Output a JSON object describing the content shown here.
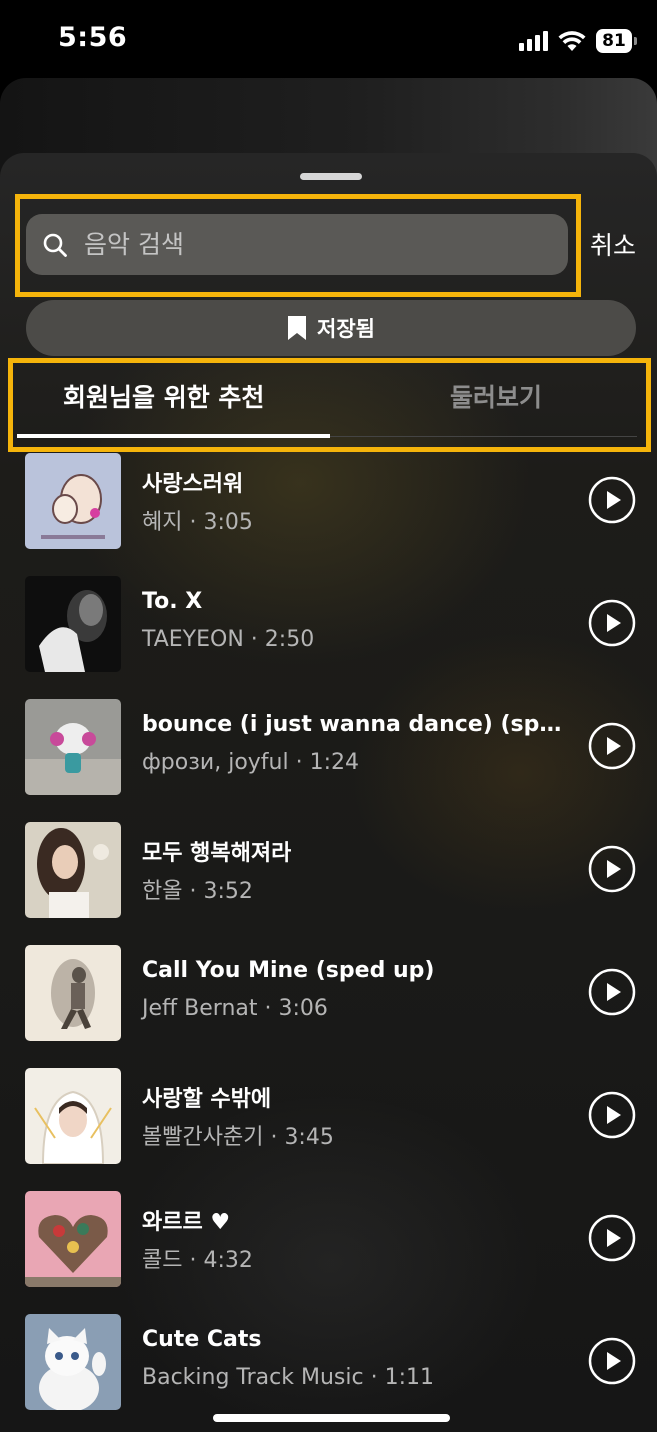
{
  "status_bar": {
    "time": "5:56",
    "battery": "81"
  },
  "search": {
    "placeholder": "음악 검색",
    "cancel_label": "취소"
  },
  "saved": {
    "label": "저장됨"
  },
  "tabs": [
    {
      "label": "회원님을 위한 추천",
      "selected": true
    },
    {
      "label": "둘러보기",
      "selected": false
    }
  ],
  "songs": [
    {
      "title": "사랑스러워",
      "artist": "혜지",
      "duration": "3:05"
    },
    {
      "title": "To. X",
      "artist": "TAEYEON",
      "duration": "2:50"
    },
    {
      "title": "bounce (i just wanna dance) (sped...",
      "artist": "фрози, joyful",
      "duration": "1:24"
    },
    {
      "title": "모두 행복해져라",
      "artist": "한올",
      "duration": "3:52"
    },
    {
      "title": "Call You Mine (sped up)",
      "artist": "Jeff Bernat",
      "duration": "3:06"
    },
    {
      "title": "사랑할 수밖에",
      "artist": "볼빨간사춘기",
      "duration": "3:45"
    },
    {
      "title": "와르르 ♥",
      "artist": "콜드",
      "duration": "4:32"
    },
    {
      "title": "Cute Cats",
      "artist": "Backing Track Music",
      "duration": "1:11"
    }
  ],
  "colors": {
    "highlight": "#f5b40b",
    "search_bg": "#5a5956",
    "saved_bg": "#4c4b48"
  },
  "icons": {
    "search": "search-icon",
    "saved": "bookmark-icon",
    "play": "play-icon"
  }
}
